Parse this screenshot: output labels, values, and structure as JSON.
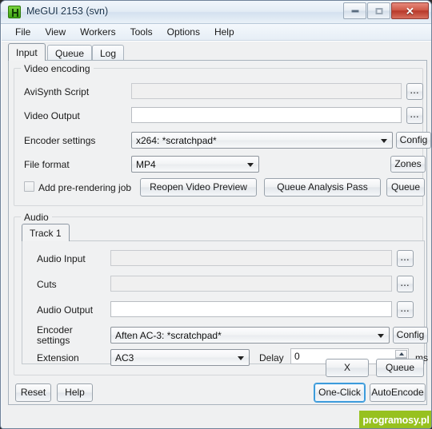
{
  "window": {
    "title": "MeGUI 2153 (svn)",
    "icon": "megui-app-icon",
    "controls": {
      "minimize": "minimize-icon",
      "maximize": "maximize-icon",
      "close": "✕"
    },
    "accent_color": "#3c9bdb",
    "close_color": "#b8392a"
  },
  "menubar": {
    "items": [
      {
        "label": "File"
      },
      {
        "label": "View"
      },
      {
        "label": "Workers"
      },
      {
        "label": "Tools"
      },
      {
        "label": "Options"
      },
      {
        "label": "Help"
      }
    ]
  },
  "tabs": [
    {
      "label": "Input",
      "active": true
    },
    {
      "label": "Queue",
      "active": false
    },
    {
      "label": "Log",
      "active": false
    }
  ],
  "video_group": {
    "title": "Video encoding",
    "rows": {
      "avisynth": {
        "label": "AviSynth Script",
        "value": "",
        "browse": "...",
        "disabled": true
      },
      "video_output": {
        "label": "Video Output",
        "value": "",
        "browse": "...",
        "disabled": false
      },
      "encoder_settings": {
        "label": "Encoder settings",
        "value": "x264: *scratchpad*",
        "config": "Config"
      },
      "file_format": {
        "label": "File format",
        "value": "MP4",
        "zones": "Zones"
      }
    },
    "prerender_checkbox": {
      "label": "Add pre-rendering job",
      "checked": false
    },
    "buttons": {
      "reopen_preview": "Reopen Video Preview",
      "queue_analysis": "Queue Analysis Pass",
      "queue": "Queue"
    }
  },
  "audio_group": {
    "title": "Audio",
    "tabs": [
      {
        "label": "Track 1",
        "active": true
      }
    ],
    "rows": {
      "audio_input": {
        "label": "Audio Input",
        "value": "",
        "browse": "...",
        "disabled": true
      },
      "cuts": {
        "label": "Cuts",
        "value": "",
        "browse": "...",
        "disabled": true
      },
      "audio_output": {
        "label": "Audio Output",
        "value": "",
        "browse": "...",
        "disabled": false
      },
      "encoder_settings": {
        "label": "Encoder\nsettings",
        "label_line1": "Encoder",
        "label_line2": "settings",
        "value": "Aften AC-3: *scratchpad*",
        "config": "Config"
      },
      "extension": {
        "label": "Extension",
        "value": "AC3"
      },
      "delay": {
        "label": "Delay",
        "value": "0",
        "unit": "ms"
      }
    },
    "buttons": {
      "remove": "X",
      "queue": "Queue"
    }
  },
  "footer": {
    "reset": "Reset",
    "help": "Help",
    "one_click": "One-Click",
    "auto_encode": "AutoEncode"
  },
  "watermark": {
    "text": "programosy.pl",
    "color": "#97c11f"
  }
}
